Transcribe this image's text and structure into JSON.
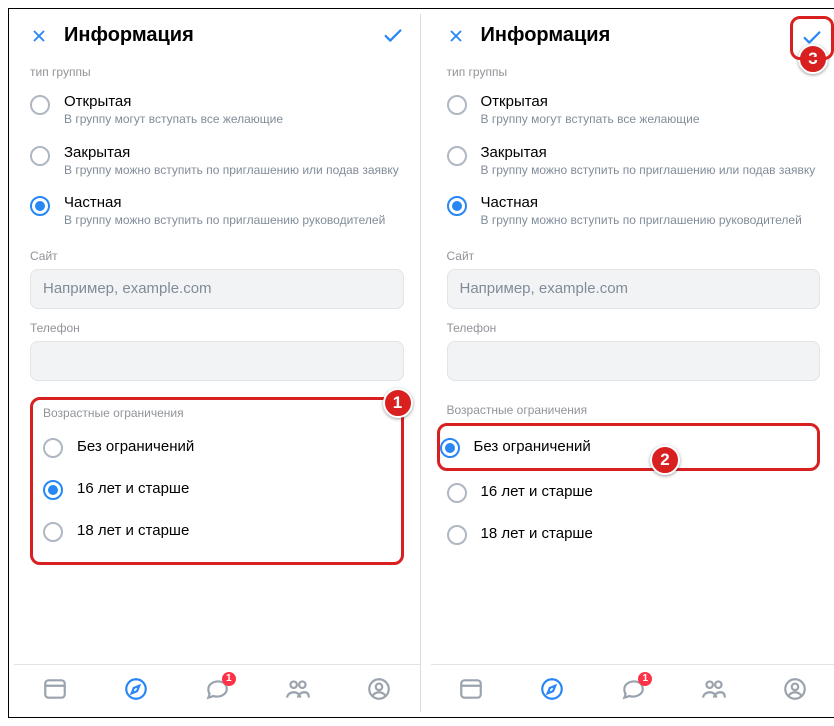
{
  "header": {
    "title": "Информация"
  },
  "groupType": {
    "label": "тип группы",
    "options": [
      {
        "title": "Открытая",
        "desc": "В группу могут вступать все желающие"
      },
      {
        "title": "Закрытая",
        "desc": "В группу можно вступить по приглашению или подав заявку"
      },
      {
        "title": "Частная",
        "desc": "В группу можно вступить по приглашению руководителей"
      }
    ]
  },
  "site": {
    "label": "Сайт",
    "placeholder": "Например, example.com"
  },
  "phone": {
    "label": "Телефон"
  },
  "age": {
    "label": "Возрастные ограничения",
    "options": [
      "Без ограничений",
      "16 лет и старше",
      "18 лет и старше"
    ]
  },
  "badges": {
    "b1": "1",
    "b2": "2",
    "b3": "3"
  },
  "tabbar": {
    "msgBadge": "1"
  },
  "left": {
    "ageSelectedIndex": 1
  },
  "right": {
    "ageSelectedIndex": 0
  }
}
